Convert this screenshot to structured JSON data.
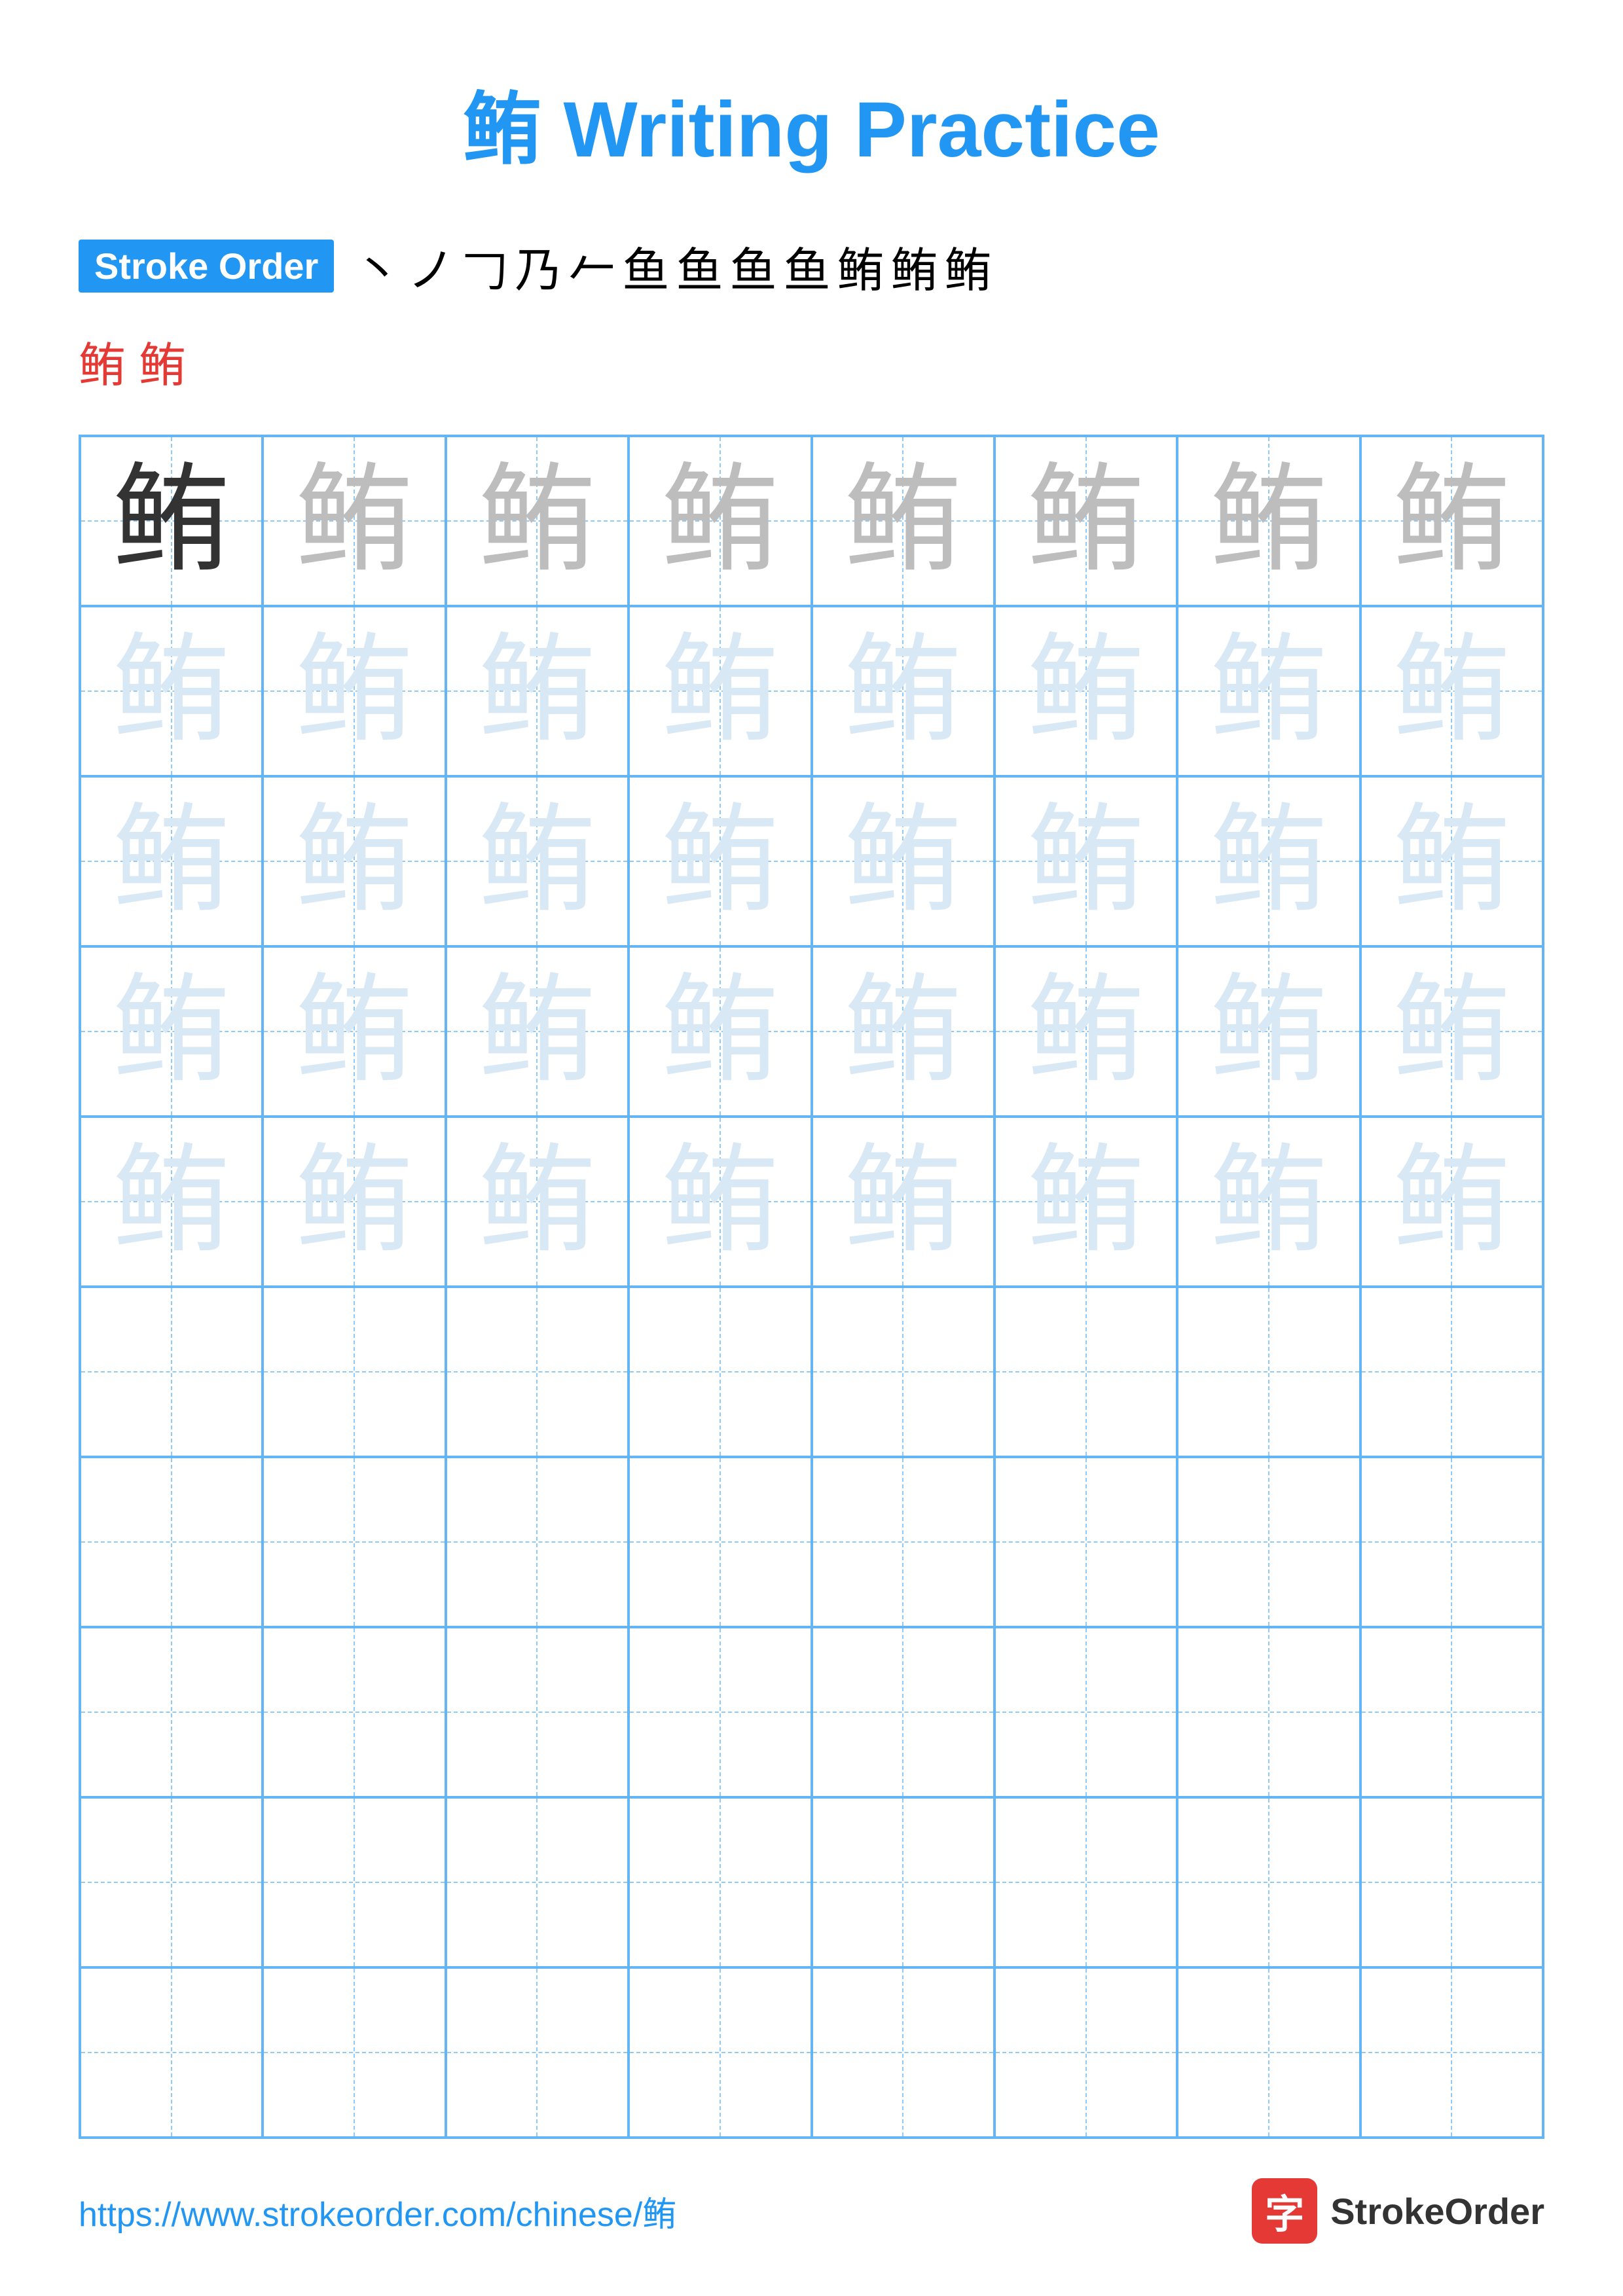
{
  "title": "鲔 Writing Practice",
  "strokeOrder": {
    "label": "Stroke Order",
    "chars": [
      "丶",
      "ノ",
      "𠃌",
      "乃",
      "𠂉",
      "鱼",
      "鱼",
      "鱼",
      "鱼",
      "鲔",
      "鲔",
      "鲔"
    ],
    "extraChars": [
      "鲔",
      "鲔"
    ]
  },
  "character": "鲔",
  "grid": {
    "rows": 10,
    "cols": 8
  },
  "footer": {
    "url": "https://www.strokeorder.com/chinese/鲔",
    "logoChar": "字",
    "logoText": "StrokeOrder"
  },
  "cellStyles": [
    [
      "dark",
      "medium",
      "medium",
      "medium",
      "medium",
      "medium",
      "medium",
      "medium"
    ],
    [
      "light",
      "light",
      "light",
      "light",
      "light",
      "light",
      "light",
      "light"
    ],
    [
      "light",
      "light",
      "light",
      "light",
      "light",
      "light",
      "light",
      "light"
    ],
    [
      "light",
      "light",
      "light",
      "light",
      "light",
      "light",
      "light",
      "light"
    ],
    [
      "light",
      "light",
      "light",
      "light",
      "light",
      "light",
      "light",
      "light"
    ],
    [
      "empty",
      "empty",
      "empty",
      "empty",
      "empty",
      "empty",
      "empty",
      "empty"
    ],
    [
      "empty",
      "empty",
      "empty",
      "empty",
      "empty",
      "empty",
      "empty",
      "empty"
    ],
    [
      "empty",
      "empty",
      "empty",
      "empty",
      "empty",
      "empty",
      "empty",
      "empty"
    ],
    [
      "empty",
      "empty",
      "empty",
      "empty",
      "empty",
      "empty",
      "empty",
      "empty"
    ],
    [
      "empty",
      "empty",
      "empty",
      "empty",
      "empty",
      "empty",
      "empty",
      "empty"
    ]
  ]
}
